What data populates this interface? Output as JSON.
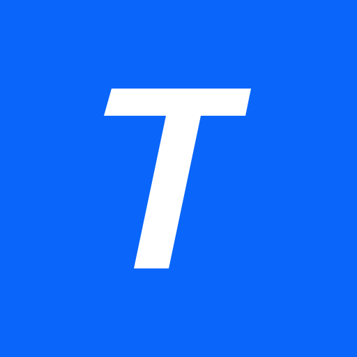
{
  "icon": {
    "name": "T-logo-icon",
    "letter": "T",
    "background_color": "#0A66FA",
    "glyph_color": "#FFFFFF"
  }
}
